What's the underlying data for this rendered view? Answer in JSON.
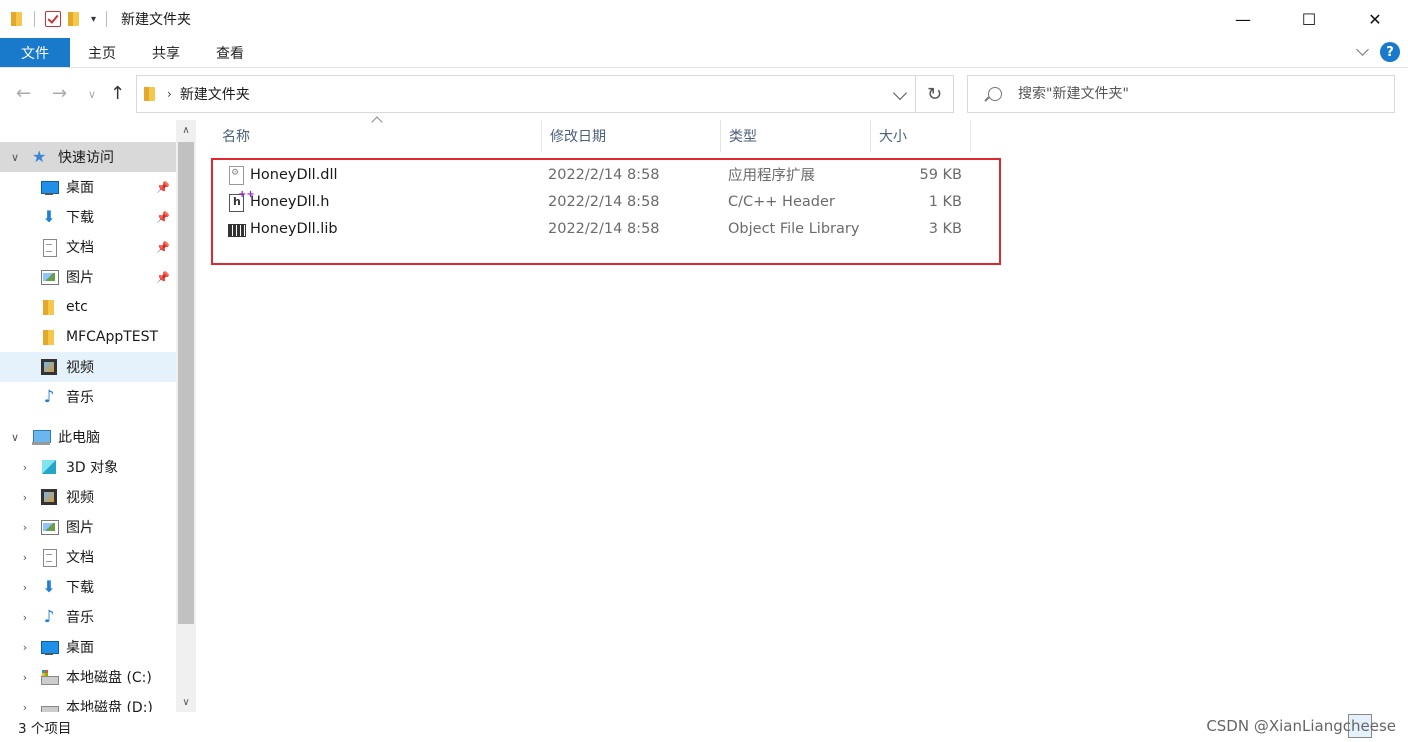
{
  "window": {
    "title": "新建文件夹",
    "controls": {
      "minimize": "—",
      "maximize": "☐",
      "close": "✕"
    }
  },
  "ribbon": {
    "tabs": [
      "文件",
      "主页",
      "共享",
      "查看"
    ],
    "help": "?"
  },
  "address": {
    "path": "新建文件夹",
    "search_placeholder": "搜索\"新建文件夹\""
  },
  "sidebar": {
    "items": [
      {
        "label": "快速访问",
        "icon": "star-icon",
        "pinned": false
      },
      {
        "label": "桌面",
        "icon": "desktop-icon",
        "pinned": true
      },
      {
        "label": "下载",
        "icon": "download-icon",
        "pinned": true
      },
      {
        "label": "文档",
        "icon": "document-icon",
        "pinned": true
      },
      {
        "label": "图片",
        "icon": "picture-icon",
        "pinned": true
      },
      {
        "label": "etc",
        "icon": "folder-icon",
        "pinned": false
      },
      {
        "label": "MFCAppTEST",
        "icon": "folder-icon",
        "pinned": false
      },
      {
        "label": "视频",
        "icon": "video-icon",
        "pinned": false
      },
      {
        "label": "音乐",
        "icon": "music-icon",
        "pinned": false
      },
      {
        "label": "此电脑",
        "icon": "computer-icon",
        "pinned": false
      },
      {
        "label": "3D 对象",
        "icon": "3d-objects-icon",
        "pinned": false
      },
      {
        "label": "视频",
        "icon": "video-icon",
        "pinned": false
      },
      {
        "label": "图片",
        "icon": "picture-icon",
        "pinned": false
      },
      {
        "label": "文档",
        "icon": "document-icon",
        "pinned": false
      },
      {
        "label": "下载",
        "icon": "download-icon",
        "pinned": false
      },
      {
        "label": "音乐",
        "icon": "music-icon",
        "pinned": false
      },
      {
        "label": "桌面",
        "icon": "desktop-icon",
        "pinned": false
      },
      {
        "label": "本地磁盘 (C:)",
        "icon": "drive-c-icon",
        "pinned": false
      },
      {
        "label": "本地磁盘 (D:)",
        "icon": "drive-d-icon",
        "pinned": false
      }
    ]
  },
  "columns": {
    "name": "名称",
    "date": "修改日期",
    "type": "类型",
    "size": "大小"
  },
  "files": [
    {
      "name": "HoneyDll.dll",
      "date": "2022/2/14 8:58",
      "type": "应用程序扩展",
      "size": "59 KB",
      "icon": "dll-file-icon"
    },
    {
      "name": "HoneyDll.h",
      "date": "2022/2/14 8:58",
      "type": "C/C++ Header",
      "size": "1 KB",
      "icon": "header-file-icon"
    },
    {
      "name": "HoneyDll.lib",
      "date": "2022/2/14 8:58",
      "type": "Object File Library",
      "size": "3 KB",
      "icon": "lib-file-icon"
    }
  ],
  "status": {
    "count": "3 个项目",
    "watermark": "CSDN @XianLiangcheese"
  },
  "colors": {
    "file_tab": "#1979ca",
    "highlight_box": "#e0282e",
    "selected_item": "#e5f1fb"
  }
}
